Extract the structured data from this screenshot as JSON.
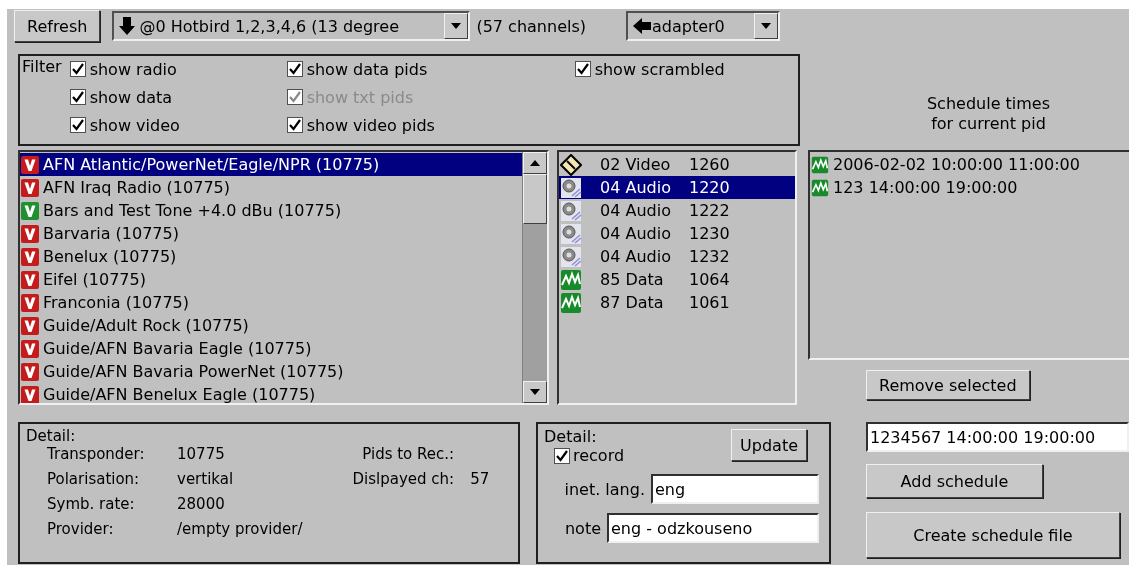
{
  "toolbar": {
    "refresh": "Refresh",
    "satellite": "@0 Hotbird 1,2,3,4,6 (13 degree",
    "channel_count": "(57 channels)",
    "adapter": "adapter0"
  },
  "filter": {
    "label": "Filter",
    "options": [
      {
        "label": "show radio",
        "checked": true,
        "disabled": false
      },
      {
        "label": "show data",
        "checked": true,
        "disabled": false
      },
      {
        "label": "show video",
        "checked": true,
        "disabled": false
      },
      {
        "label": "show data pids",
        "checked": true,
        "disabled": false
      },
      {
        "label": "show txt pids",
        "checked": true,
        "disabled": true
      },
      {
        "label": "show video pids",
        "checked": true,
        "disabled": false
      },
      {
        "label": "show scrambled",
        "checked": true,
        "disabled": false
      }
    ]
  },
  "schedule_header": "Schedule times\nfor current pid",
  "channels": [
    {
      "name": "AFN Atlantic/PowerNet/Eagle/NPR (10775)",
      "color": "#c41c1c",
      "selected": true
    },
    {
      "name": "AFN Iraq Radio (10775)",
      "color": "#c41c1c",
      "selected": false
    },
    {
      "name": "Bars and Test Tone +4.0 dBu (10775)",
      "color": "#1f8f2f",
      "selected": false
    },
    {
      "name": "Barvaria (10775)",
      "color": "#c41c1c",
      "selected": false
    },
    {
      "name": "Benelux (10775)",
      "color": "#c41c1c",
      "selected": false
    },
    {
      "name": "Eifel (10775)",
      "color": "#c41c1c",
      "selected": false
    },
    {
      "name": "Franconia (10775)",
      "color": "#c41c1c",
      "selected": false
    },
    {
      "name": "Guide/Adult Rock (10775)",
      "color": "#c41c1c",
      "selected": false
    },
    {
      "name": "Guide/AFN Bavaria Eagle (10775)",
      "color": "#c41c1c",
      "selected": false
    },
    {
      "name": "Guide/AFN Bavaria PowerNet (10775)",
      "color": "#c41c1c",
      "selected": false
    },
    {
      "name": "Guide/AFN Benelux Eagle (10775)",
      "color": "#c41c1c",
      "selected": false
    }
  ],
  "pids": [
    {
      "kind": "video",
      "label": "02 Video",
      "pid": "1260",
      "selected": false
    },
    {
      "kind": "audio",
      "label": "04 Audio",
      "pid": "1220",
      "selected": true
    },
    {
      "kind": "audio",
      "label": "04 Audio",
      "pid": "1222",
      "selected": false
    },
    {
      "kind": "audio",
      "label": "04 Audio",
      "pid": "1230",
      "selected": false
    },
    {
      "kind": "audio",
      "label": "04 Audio",
      "pid": "1232",
      "selected": false
    },
    {
      "kind": "data",
      "label": "85 Data",
      "pid": "1064",
      "selected": false
    },
    {
      "kind": "data",
      "label": "87 Data",
      "pid": "1061",
      "selected": false
    }
  ],
  "schedules": [
    "2006-02-02 10:00:00 11:00:00",
    "123 14:00:00 19:00:00"
  ],
  "remove_button": "Remove selected",
  "schedule_input": "1234567 14:00:00 19:00:00",
  "add_button": "Add schedule",
  "create_button": "Create schedule file",
  "channel_detail": {
    "title": "Detail:",
    "rows": [
      {
        "label": "Transponder:",
        "value": "10775"
      },
      {
        "label": "Polarisation:",
        "value": "vertikal"
      },
      {
        "label": "Symb. rate:",
        "value": "28000"
      },
      {
        "label": "Provider:",
        "value": "/empty provider/"
      }
    ],
    "stats": [
      {
        "label": "Pids to Rec.:"
      },
      {
        "label": "Dislpayed ch:",
        "value": "57"
      }
    ]
  },
  "pid_detail": {
    "title": "Detail:",
    "update": "Update",
    "record": {
      "label": "record",
      "checked": true
    },
    "lang": {
      "label": "inet. lang.",
      "value": "eng"
    },
    "note": {
      "label": "note",
      "value": "eng - odzkouseno"
    }
  }
}
